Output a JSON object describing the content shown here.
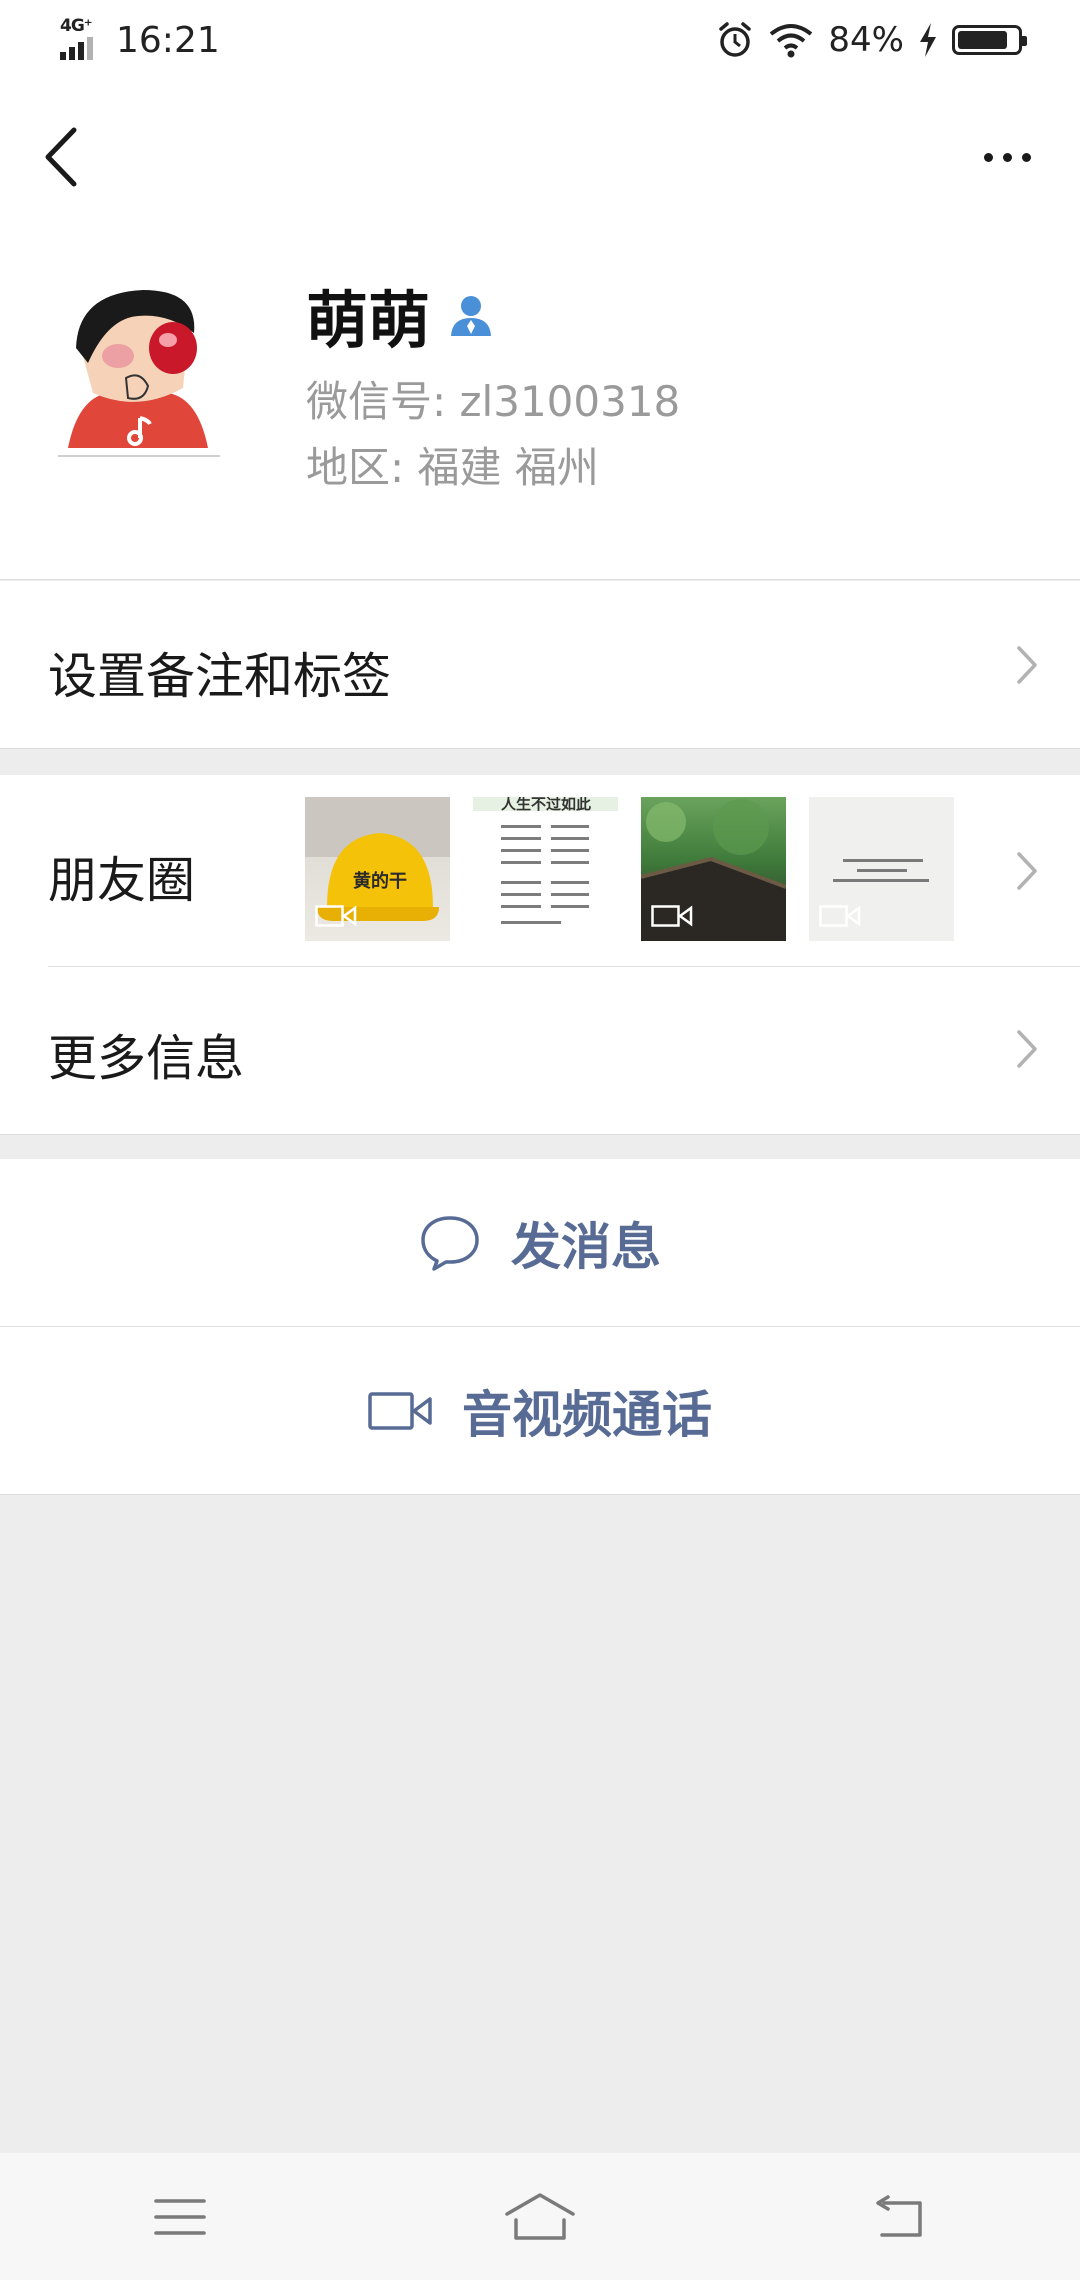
{
  "status_bar": {
    "network": "4G⁺",
    "time": "16:21",
    "battery_percent": "84%",
    "battery_level": 0.84
  },
  "nav": {
    "back_icon": "chevron-left-icon",
    "more_icon": "more-dots-icon"
  },
  "profile": {
    "name": "萌萌",
    "gender_icon": "person-icon",
    "gender_color": "#4a90d9",
    "wechat_id": "微信号: zl3100318",
    "region": "地区: 福建  福州"
  },
  "cells": {
    "remark_label": "设置备注和标签",
    "moments_label": "朋友圈",
    "more_info_label": "更多信息"
  },
  "moments_thumbnails": {
    "helmet_text": "黄的干",
    "text_title": "人生不过如此"
  },
  "actions": {
    "message_label": "发消息",
    "call_label": "音视频通话",
    "accent_color": "#576b95"
  }
}
